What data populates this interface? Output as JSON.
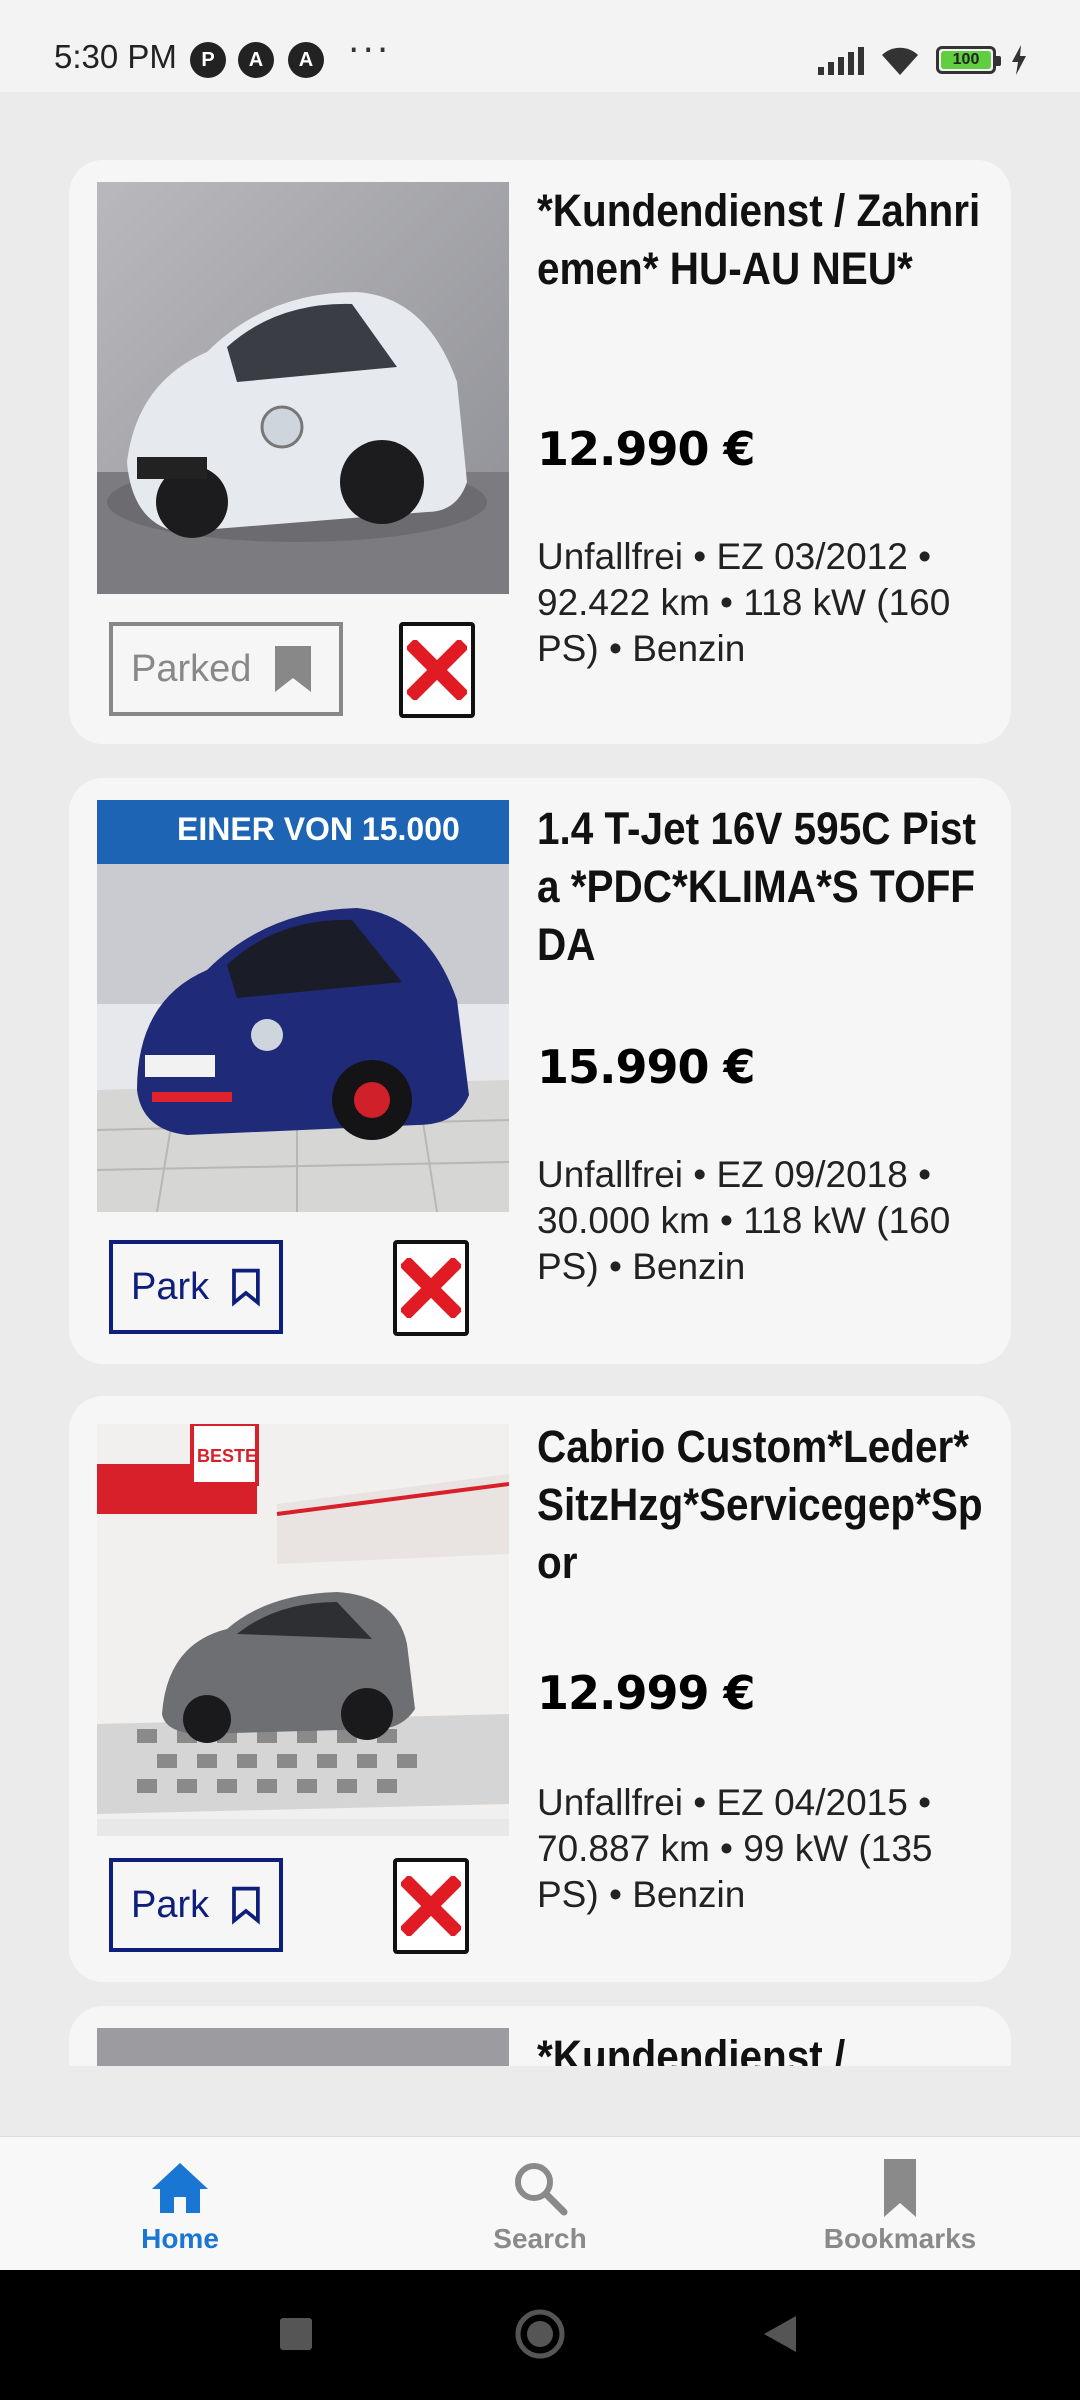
{
  "status_bar": {
    "time": "5:30 PM",
    "app_icons": [
      "P",
      "A",
      "A"
    ],
    "more": "···",
    "battery": "100"
  },
  "listings": [
    {
      "title": "*Kundendienst / Zahnriemen* HU-AU NEU*",
      "price": "12.990 €",
      "details": "Unfallfrei • EZ 03/2012 • 92.422 km • 118 kW (160 PS) • Benzin",
      "park_label": "Parked",
      "parked": true,
      "photo_banner": ""
    },
    {
      "title": "1.4 T-Jet 16V 595C Pista *PDC*KLIMA*S TOFFDA",
      "price": "15.990 €",
      "details": "Unfallfrei • EZ 09/2018 • 30.000 km • 118 kW (160 PS) • Benzin",
      "park_label": "Park",
      "parked": false,
      "photo_banner": "EINER VON 15.000"
    },
    {
      "title": "Cabrio Custom*Leder*SitzHzg*Servicegep*Spor",
      "price": "12.999 €",
      "details": "Unfallfrei • EZ 04/2015 • 70.887 km • 99 kW (135 PS) • Benzin",
      "park_label": "Park",
      "parked": false,
      "photo_banner": "BESTE"
    },
    {
      "title": "*Kundendienst /",
      "price": "",
      "details": "",
      "park_label": "",
      "parked": false,
      "photo_banner": ""
    }
  ],
  "bottom_nav": {
    "home": "Home",
    "search": "Search",
    "bookmarks": "Bookmarks"
  },
  "colors": {
    "accent": "#1976d2",
    "park_border": "#0d1f7a",
    "delete_red": "#e01b24",
    "card_bg": "#f6f6f6",
    "page_bg": "#ebebeb"
  }
}
